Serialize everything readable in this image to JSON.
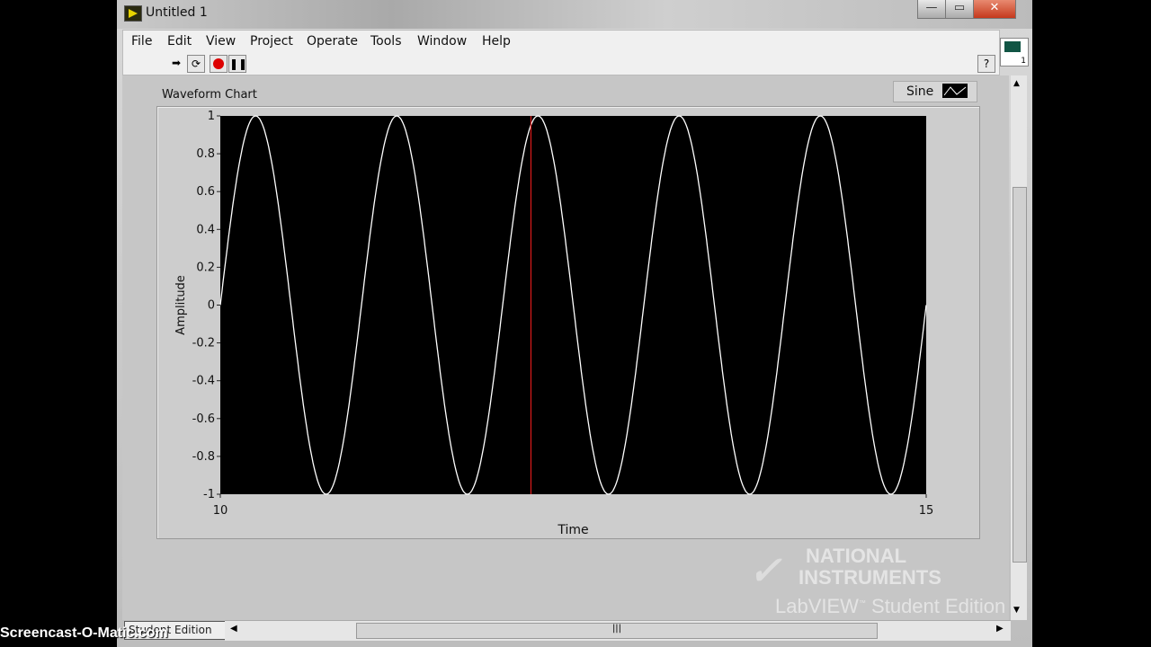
{
  "window": {
    "title": "Untitled 1",
    "controls": [
      "minimize",
      "maximize",
      "close"
    ]
  },
  "menu": [
    "File",
    "Edit",
    "View",
    "Project",
    "Operate",
    "Tools",
    "Window",
    "Help"
  ],
  "toolbar": {
    "buttons": [
      "run-arrow-icon",
      "run-continuously-icon",
      "abort-icon",
      "pause-icon"
    ],
    "help": "?"
  },
  "vi_icon": {
    "label": "1"
  },
  "chart": {
    "label": "Waveform Chart",
    "legend": "Sine",
    "xlabel": "Time",
    "ylabel": "Amplitude"
  },
  "chart_data": {
    "type": "line",
    "title": "Waveform Chart",
    "xlabel": "Time",
    "ylabel": "Amplitude",
    "xlim": [
      10,
      15
    ],
    "ylim": [
      -1,
      1
    ],
    "x_ticks": [
      "10",
      "15"
    ],
    "y_ticks": [
      "1",
      "0.8",
      "0.6",
      "0.4",
      "0.2",
      "0",
      "-0.2",
      "-0.4",
      "-0.6",
      "-0.8",
      "-1"
    ],
    "series": [
      {
        "name": "Sine",
        "function": "sin",
        "amplitude": 1,
        "period": 1,
        "phase_start": 10,
        "color": "#ffffff"
      }
    ],
    "cursor_x": 12.2,
    "cursor_color": "#ff2020",
    "background": "#000000",
    "grid": false,
    "legend_position": "top-right"
  },
  "status": {
    "edition_box": "Student Edition"
  },
  "logo": {
    "line1": "NATIONAL",
    "line2": "INSTRUMENTS",
    "line3": "LabVIEW™ Student Edition"
  },
  "watermark": "Screencast-O-Matic.com"
}
